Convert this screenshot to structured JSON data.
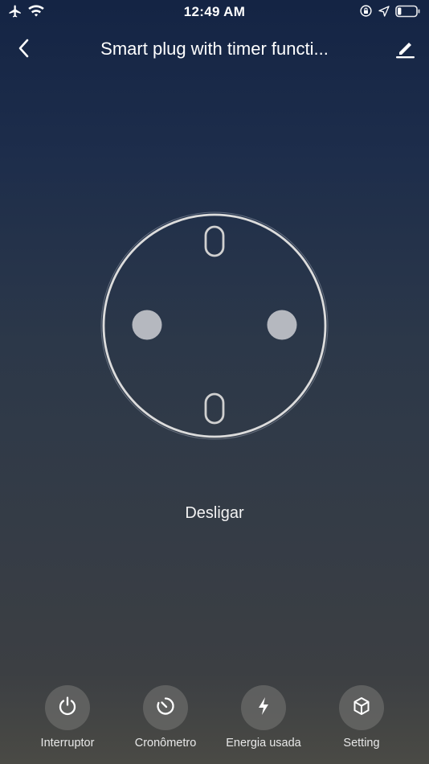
{
  "status_bar": {
    "time": "12:49 AM",
    "left_icons": [
      "airplane-icon",
      "wifi-icon"
    ],
    "right_icons": [
      "orientation-lock-icon",
      "location-icon",
      "battery-icon"
    ],
    "battery_level": 0.2
  },
  "header": {
    "title": "Smart plug with timer functi...",
    "back_icon": "chevron-left-icon",
    "edit_icon": "pencil-icon"
  },
  "main": {
    "socket_icon": "power-socket-icon",
    "state_label": "Desligar"
  },
  "functions": [
    {
      "label": "Interruptor",
      "icon": "power-icon"
    },
    {
      "label": "Cronômetro",
      "icon": "timer-icon"
    },
    {
      "label": "Energia usada",
      "icon": "lightning-icon"
    },
    {
      "label": "Setting",
      "icon": "cube-icon"
    }
  ],
  "colors": {
    "socket_outline": "#d9d9d9",
    "socket_holes": "#b5b8bf",
    "button_bg": "#78787a"
  }
}
